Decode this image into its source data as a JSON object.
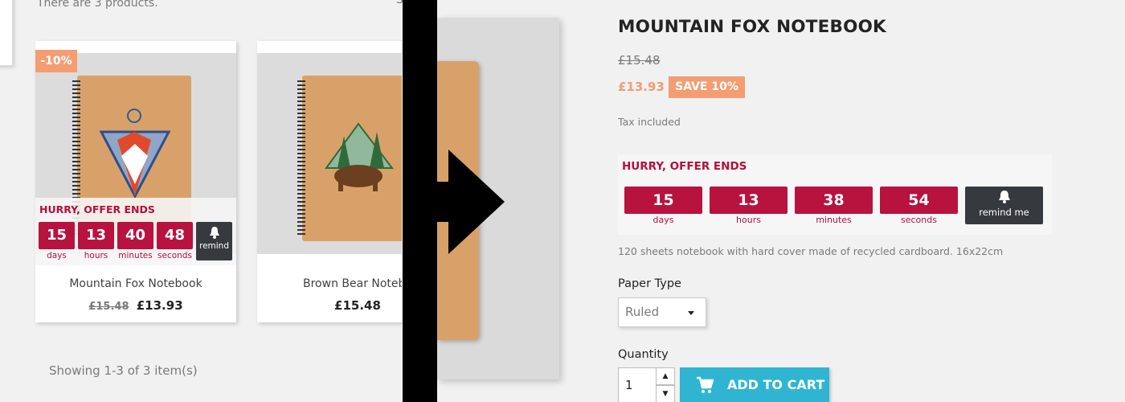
{
  "listing": {
    "count_text": "There are 3 products.",
    "showing_text": "Showing 1-3 of 3 item(s)",
    "products": [
      {
        "name": "Mountain Fox Notebook",
        "old_price": "£15.48",
        "price": "£13.93",
        "discount_flag": "-10%"
      },
      {
        "name": "Brown Bear Notebo",
        "price": "£15.48"
      }
    ],
    "mini_timer": {
      "hurry": "HURRY, OFFER ENDS",
      "days": "15",
      "days_label": "days",
      "hours": "13",
      "hours_label": "hours",
      "minutes": "40",
      "minutes_label": "minutes",
      "seconds": "48",
      "seconds_label": "seconds",
      "remind_label": "remind"
    }
  },
  "middle": {
    "breadcrumb_fragment": "S"
  },
  "product": {
    "title": "MOUNTAIN FOX NOTEBOOK",
    "old_price": "£15.48",
    "price": "£13.93",
    "save_badge": "SAVE 10%",
    "tax_text": "Tax included",
    "timer": {
      "hurry": "HURRY, OFFER ENDS",
      "days": "15",
      "days_label": "days",
      "hours": "13",
      "hours_label": "hours",
      "minutes": "38",
      "minutes_label": "minutes",
      "seconds": "54",
      "seconds_label": "seconds",
      "remind_label": "remind me"
    },
    "description": "120 sheets notebook with hard cover made of recycled cardboard. 16x22cm",
    "paper_type_label": "Paper Type",
    "paper_type_value": "Ruled",
    "quantity_label": "Quantity",
    "quantity_value": "1",
    "add_to_cart_label": "ADD TO CART"
  },
  "colors": {
    "accent": "#f39d72",
    "timer_red": "#b8123f",
    "cart_button": "#2fb5d2",
    "dark": "#363a3e"
  },
  "icons": [
    "bell-icon",
    "cart-icon",
    "caret-down-icon",
    "arrow-up-icon",
    "arrow-down-icon",
    "right-arrow-icon"
  ]
}
